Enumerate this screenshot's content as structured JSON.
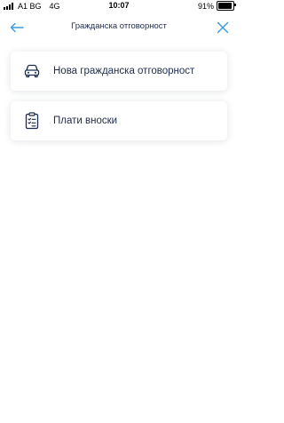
{
  "status_bar": {
    "carrier": "A1 BG",
    "network": "4G",
    "time": "10:07",
    "battery": "91%",
    "battery_level": 0.91
  },
  "header": {
    "title": "Гражданска отговорност",
    "back_icon": "arrow-left-icon",
    "close_icon": "close-icon"
  },
  "options": [
    {
      "label": "Нова гражданска отговорност",
      "icon": "car-icon"
    },
    {
      "label": "Плати вноски",
      "icon": "clipboard-checklist-icon"
    }
  ],
  "colors": {
    "accent": "#3a9ad9",
    "text": "#1f2b4d",
    "icon": "#1f2b4d"
  }
}
